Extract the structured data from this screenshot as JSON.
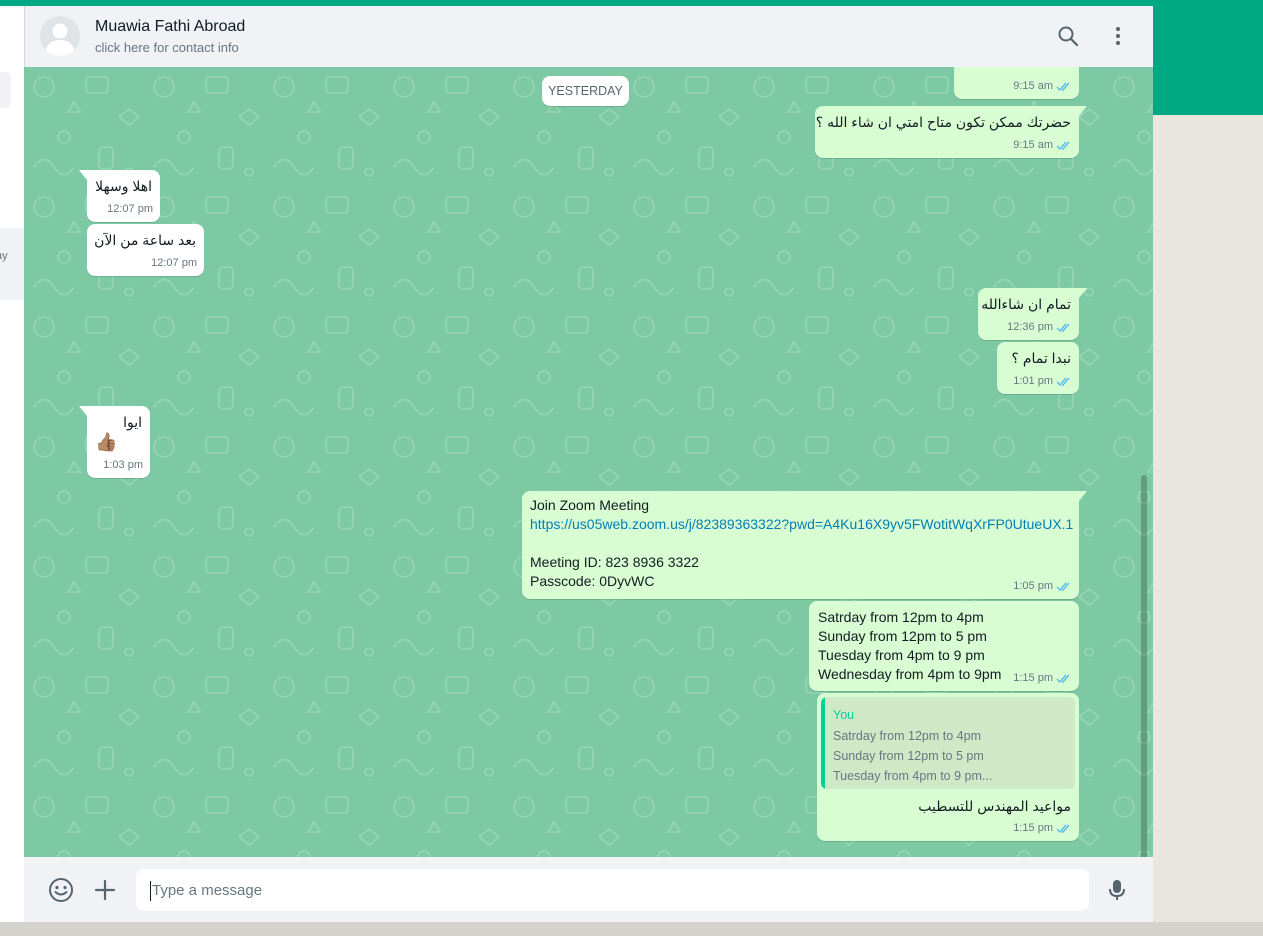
{
  "header": {
    "contact_name": "Muawia Fathi Abroad",
    "contact_sub": "click here for contact info",
    "icons": [
      "search-icon",
      "menu-dots-icon"
    ]
  },
  "left_panel": {
    "snippet": "ay"
  },
  "date_chip": "YESTERDAY",
  "messages": [
    {
      "dir": "out",
      "text": "",
      "time": "9:15 am",
      "status": "read"
    },
    {
      "dir": "out",
      "text": "حضرتك ممكن تكون متاح امتي ان شاء الله ؟",
      "time": "9:15 am",
      "status": "read"
    },
    {
      "dir": "in",
      "text": "اهلا وسهلا",
      "time": "12:07 pm"
    },
    {
      "dir": "in",
      "text": "بعد ساعة من الآن",
      "time": "12:07 pm"
    },
    {
      "dir": "out",
      "text": "تمام ان شاءالله",
      "time": "12:36 pm",
      "status": "read"
    },
    {
      "dir": "out",
      "text": "نبدا تمام ؟",
      "time": "1:01 pm",
      "status": "read"
    },
    {
      "dir": "in",
      "text": "ايوا",
      "emoji": "👍🏽",
      "time": "1:03 pm"
    },
    {
      "dir": "out",
      "lines": [
        "Join Zoom Meeting",
        "https://us05web.zoom.us/j/82389363322?pwd=A4Ku16X9yv5FWotitWqXrFP0UtueUX.1",
        "",
        "Meeting ID: 823 8936 3322",
        "Passcode: 0DyvWC"
      ],
      "time": "1:05 pm",
      "status": "read"
    },
    {
      "dir": "out",
      "lines": [
        "Satrday from 12pm to 4pm",
        "Sunday from 12pm to 5 pm",
        "Tuesday from 4pm to 9 pm",
        "Wednesday from 4pm to 9pm"
      ],
      "time": "1:15 pm",
      "status": "read"
    },
    {
      "dir": "out",
      "quote": {
        "author": "You",
        "lines": [
          "Satrday from 12pm to 4pm",
          "Sunday from 12pm to 5 pm",
          "Tuesday from 4pm to 9 pm..."
        ]
      },
      "text": "مواعيد المهندس للتسطيب",
      "time": "1:15 pm",
      "status": "read"
    }
  ],
  "composer": {
    "placeholder": "Type a message",
    "icons": [
      "emoji-icon",
      "attach-plus-icon",
      "microphone-icon"
    ]
  },
  "colors": {
    "accent": "#00a884",
    "chat_bg": "#7dc9a3",
    "out_bubble": "#d9fdd3",
    "in_bubble": "#ffffff",
    "read_tick": "#53bdeb",
    "link": "#027eb5",
    "quote_author": "#06cf9c"
  }
}
